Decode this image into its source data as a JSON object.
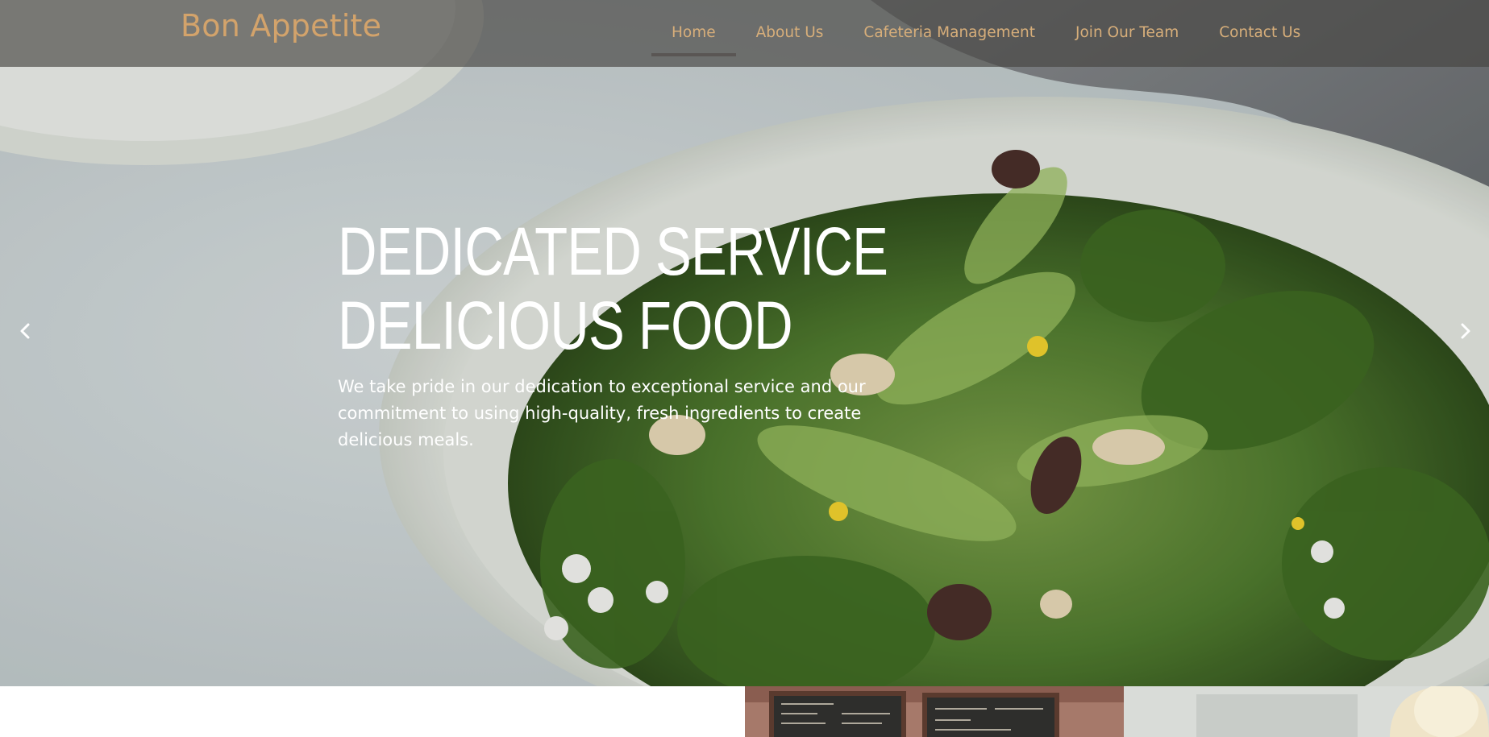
{
  "brand": {
    "name": "Bon Appetite",
    "color": "#d3a36b"
  },
  "nav": {
    "items": [
      {
        "label": "Home",
        "active": true
      },
      {
        "label": "About Us",
        "active": false
      },
      {
        "label": "Cafeteria Management",
        "active": false
      },
      {
        "label": "Join Our Team",
        "active": false
      },
      {
        "label": "Contact Us",
        "active": false
      }
    ],
    "text_color": "#d7ae7a"
  },
  "hero": {
    "headline_line1": "DEDICATED SERVICE",
    "headline_line2": "DELICIOUS FOOD",
    "subtext": "We take pride in our dedication to exceptional service and our commitment to using high-quality, fresh ingredients to create delicious meals.",
    "image": "salad-plate-photo",
    "prev_icon": "chevron-left-icon",
    "next_icon": "chevron-right-icon"
  },
  "below": {
    "image": "cafeteria-photo"
  }
}
